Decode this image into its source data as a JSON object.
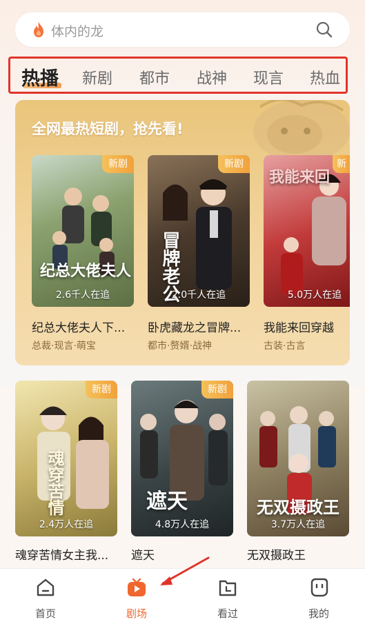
{
  "search": {
    "placeholder": "体内的龙"
  },
  "tabs": [
    "热播",
    "新剧",
    "都市",
    "战神",
    "现言",
    "热血"
  ],
  "promo": {
    "title": "全网最热短剧，抢先看!",
    "cards": [
      {
        "badge": "新剧",
        "views": "2.6千人在追",
        "title": "纪总大佬夫人下...",
        "tags": "总裁·现言·萌宝",
        "poster_text": "纪总大佬夫人"
      },
      {
        "badge": "新剧",
        "views": "2.0千人在追",
        "title": "卧虎藏龙之冒牌...",
        "tags": "都市·赘婿·战神",
        "poster_text": "冒牌老公"
      },
      {
        "badge": "新",
        "views": "5.0万人在追",
        "title": "我能来回穿越",
        "tags": "古装·古言",
        "poster_text": "我能来回"
      }
    ]
  },
  "grid": [
    {
      "badge": "新剧",
      "views": "2.4万人在追",
      "title": "魂穿苦情女主我...",
      "poster_text": "魂穿苦情"
    },
    {
      "badge": "新剧",
      "views": "4.8万人在追",
      "title": "遮天",
      "poster_text": "遮天"
    },
    {
      "badge": "",
      "views": "3.7万人在追",
      "title": "无双摄政王",
      "poster_text": "无双摄政王"
    }
  ],
  "nav": [
    {
      "label": "首页",
      "icon": "home-icon"
    },
    {
      "label": "剧场",
      "icon": "theater-icon"
    },
    {
      "label": "看过",
      "icon": "history-icon"
    },
    {
      "label": "我的",
      "icon": "profile-icon"
    }
  ],
  "colors": {
    "accent": "#f0672e",
    "highlight_box": "#e0342b",
    "badge": "#f2a13c"
  }
}
